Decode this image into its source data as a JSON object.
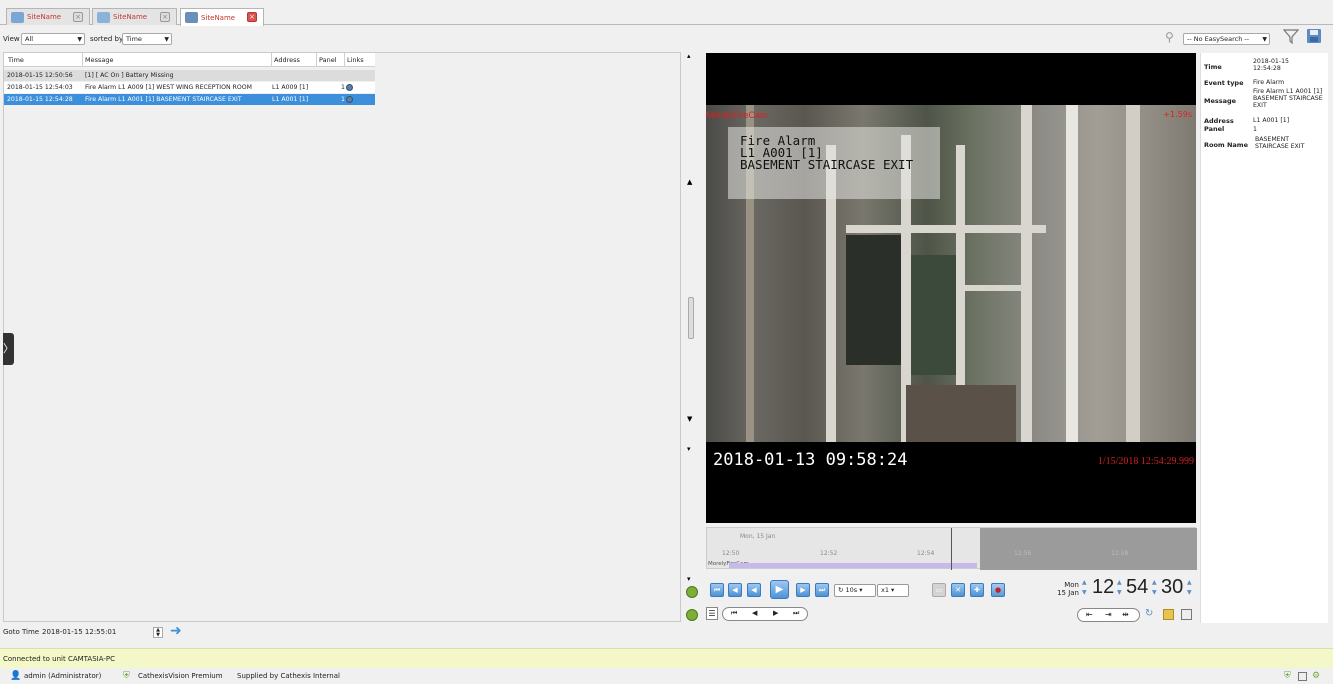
{
  "tabs": [
    {
      "label": "SiteName",
      "icon": "chart-icon",
      "active": false
    },
    {
      "label": "SiteName",
      "icon": "network-icon",
      "active": false
    },
    {
      "label": "SiteName",
      "icon": "list-icon",
      "active": true
    }
  ],
  "filters": {
    "view_label": "View",
    "view_value": "All",
    "sorted_label": "sorted by",
    "sorted_value": "Time",
    "easysearch_value": "-- No EasySearch --"
  },
  "grid": {
    "columns": [
      "Time",
      "Message",
      "Address",
      "Panel",
      "Links"
    ],
    "rows": [
      {
        "time": "2018-01-15 12:50:56",
        "message": "[1] [ AC On ] Battery Missing",
        "address": "",
        "panel": "",
        "links": "",
        "style": "grey"
      },
      {
        "time": "2018-01-15 12:54:03",
        "message": "Fire Alarm L1 A009 [1] WEST WING RECEPTION ROOM",
        "address": "L1 A009 [1]",
        "panel": "",
        "links": "1",
        "style": "white"
      },
      {
        "time": "2018-01-15 12:54:28",
        "message": "Fire Alarm L1 A001 [1] BASEMENT STAIRCASE EXIT",
        "address": "L1 A001 [1]",
        "panel": "",
        "links": "1",
        "style": "sel"
      }
    ]
  },
  "video": {
    "camera_name": "MorelyFireCam",
    "camera_offset": "+1.59s",
    "caption_line1": "Fire Alarm",
    "caption_line2": "L1 A001 [1]",
    "caption_line3": "BASEMENT STAIRCASE EXIT",
    "timestamp": "2018-01-13 09:58:24",
    "red_timestamp": "1/15/2018 12:54:29.999"
  },
  "timeline": {
    "date_label": "Mon, 15 Jan",
    "ticks": [
      "12:50",
      "12:52",
      "12:54",
      "12:56",
      "12:58"
    ],
    "track_label": "MorelyFireCam"
  },
  "playback": {
    "speed_step": "10s",
    "speed_multiplier": "x1",
    "day": "Mon",
    "date": "15 Jan",
    "hour": "12",
    "minute": "54",
    "second": "30"
  },
  "info": {
    "time_label": "Time",
    "time_value": "2018-01-15 12:54:28",
    "event_type_label": "Event type",
    "event_type_value": "Fire Alarm",
    "message_label": "Message",
    "message_value": "Fire Alarm L1 A001 [1] BASEMENT STAIRCASE EXIT",
    "address_label": "Address",
    "address_value": "L1 A001 [1]",
    "panel_label": "Panel",
    "panel_value": "1",
    "room_label": "Room Name",
    "room_value": "BASEMENT STAIRCASE EXIT"
  },
  "goto": {
    "label": "Goto Time",
    "value": "2018-01-15 12:55:01"
  },
  "status": {
    "connected": "Connected to unit CAMTASIA-PC",
    "user": "admin (Administrator)",
    "product": "CathexisVision Premium",
    "supplier": "Supplied by Cathexis Internal"
  }
}
